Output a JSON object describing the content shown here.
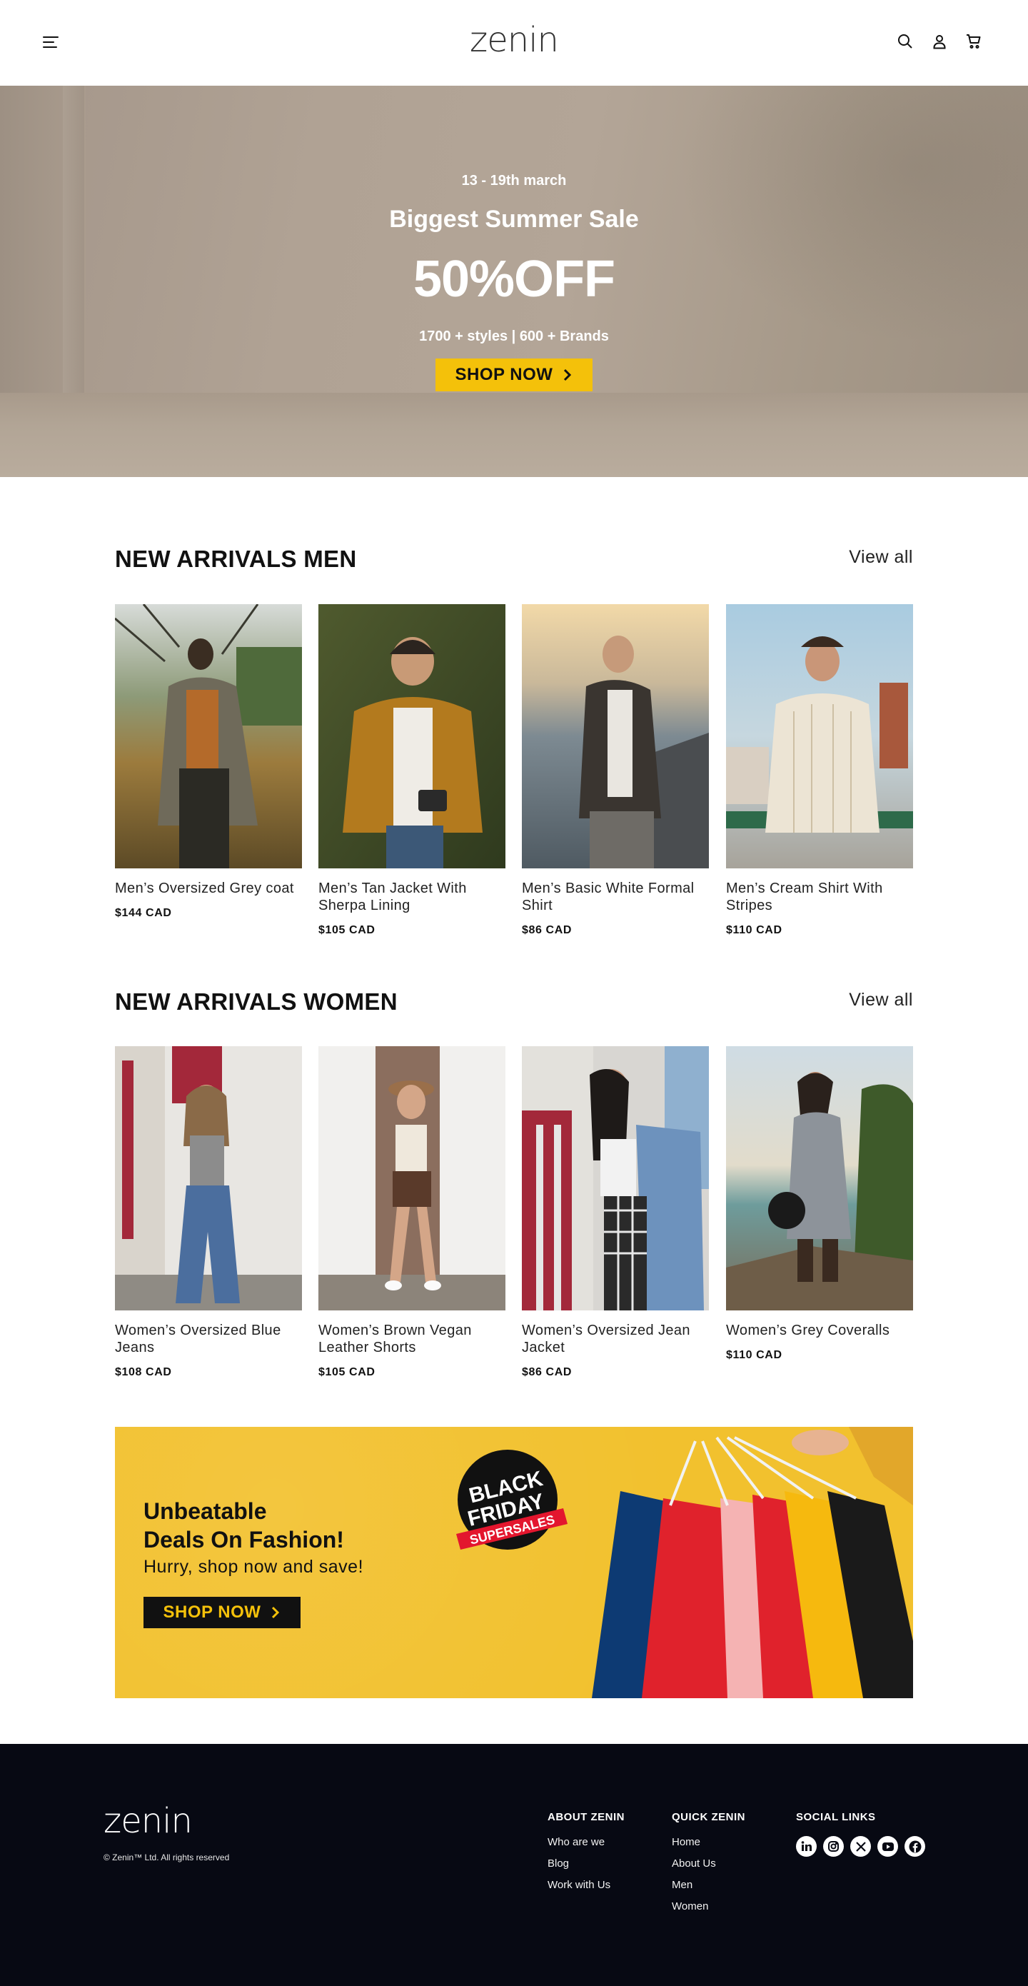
{
  "header": {
    "logo": "zenin",
    "icons": [
      "menu-icon",
      "search-icon",
      "user-icon",
      "cart-icon"
    ]
  },
  "hero": {
    "date": "13 - 19th march",
    "title": "Biggest Summer Sale",
    "discount": "50%OFF",
    "subtitle": "1700 + styles | 600 + Brands",
    "cta_label": "SHOP NOW",
    "cta_color": "#f4c10a"
  },
  "men": {
    "title": "NEW ARRIVALS MEN",
    "view_all": "View all",
    "products": [
      {
        "name": "Men’s Oversized Grey coat",
        "price": "$144 CAD"
      },
      {
        "name": "Men’s Tan Jacket With Sherpa Lining",
        "price": "$105 CAD"
      },
      {
        "name": "Men’s Basic White Formal Shirt",
        "price": "$86 CAD"
      },
      {
        "name": "Men’s Cream Shirt With Stripes",
        "price": "$110 CAD"
      }
    ]
  },
  "women": {
    "title": "NEW ARRIVALS WOMEN",
    "view_all": "View all",
    "products": [
      {
        "name": "Women’s Oversized Blue Jeans",
        "price": "$108 CAD"
      },
      {
        "name": "Women’s Brown Vegan Leather Shorts",
        "price": "$105 CAD"
      },
      {
        "name": "Women’s Oversized Jean Jacket",
        "price": "$86 CAD"
      },
      {
        "name": "Women’s Grey Coveralls",
        "price": "$110 CAD"
      }
    ]
  },
  "promo": {
    "title_line1": "Unbeatable",
    "title_line2": "Deals On Fashion!",
    "subtitle": "Hurry, shop now and save!",
    "cta_label": "SHOP NOW",
    "badge_line1": "BLACK",
    "badge_line2": "FRIDAY",
    "badge_ribbon": "SUPERSALES",
    "bg_color": "#f2c12e"
  },
  "footer": {
    "logo": "zenin",
    "copyright": "© Zenin™ Ltd. All rights reserved",
    "about": {
      "title": "ABOUT ZENIN",
      "links": [
        "Who are we",
        "Blog",
        "Work with Us"
      ]
    },
    "quick": {
      "title": "QUICK ZENIN",
      "links": [
        "Home",
        "About Us",
        "Men",
        "Women"
      ]
    },
    "social": {
      "title": "SOCIAL LINKS",
      "icons": [
        "linkedin-icon",
        "instagram-icon",
        "x-icon",
        "youtube-icon",
        "facebook-icon"
      ]
    }
  }
}
